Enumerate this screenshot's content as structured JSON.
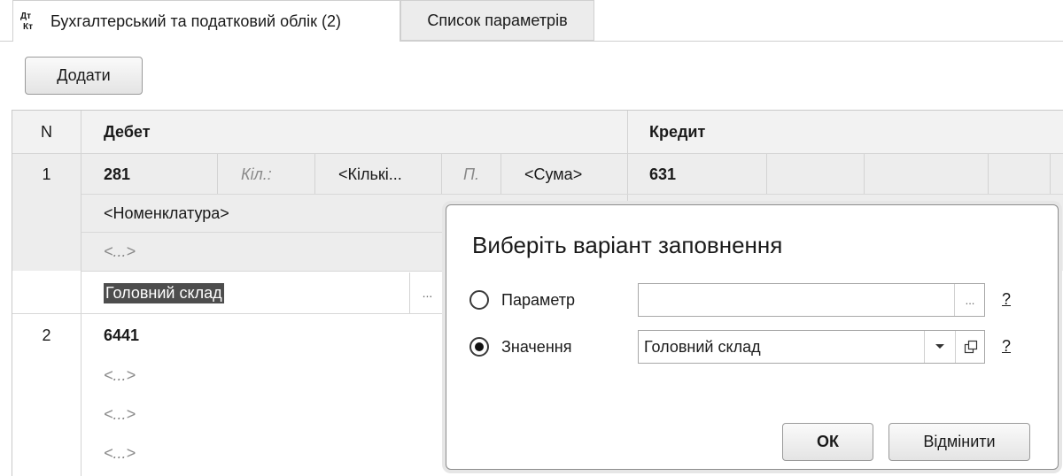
{
  "tabs": [
    {
      "label": "Бухгалтерський та податковий облік (2)",
      "icon": "dt-kt-icon",
      "icon_top": "Дт",
      "icon_bottom": "Кт"
    },
    {
      "label": "Список параметрів"
    }
  ],
  "toolbar": {
    "add_label": "Додати"
  },
  "table": {
    "headers": {
      "n": "N",
      "debit": "Дебет",
      "credit": "Кредит"
    },
    "rows": [
      {
        "n": "1",
        "debit_account": "281",
        "qty_label": "Кіл.:",
        "qty_value": "<Кількі...",
        "sum_label": "П.",
        "sum_value": "<Сума>",
        "credit_account": "631",
        "subconto": [
          "<Номенклатура>",
          "<...>",
          "Головний склад"
        ],
        "picker": "..."
      },
      {
        "n": "2",
        "debit_account": "6441",
        "subconto": [
          "<...>",
          "<...>",
          "<...>"
        ]
      }
    ]
  },
  "dialog": {
    "title": "Виберіть варіант заповнення",
    "option_parameter": "Параметр",
    "option_value": "Значення",
    "parameter_value": "",
    "parameter_picker": "...",
    "value_field": "Головний склад",
    "help": "?",
    "ok_label": "ОК",
    "cancel_label": "Відмінити",
    "selected_option": "value"
  }
}
